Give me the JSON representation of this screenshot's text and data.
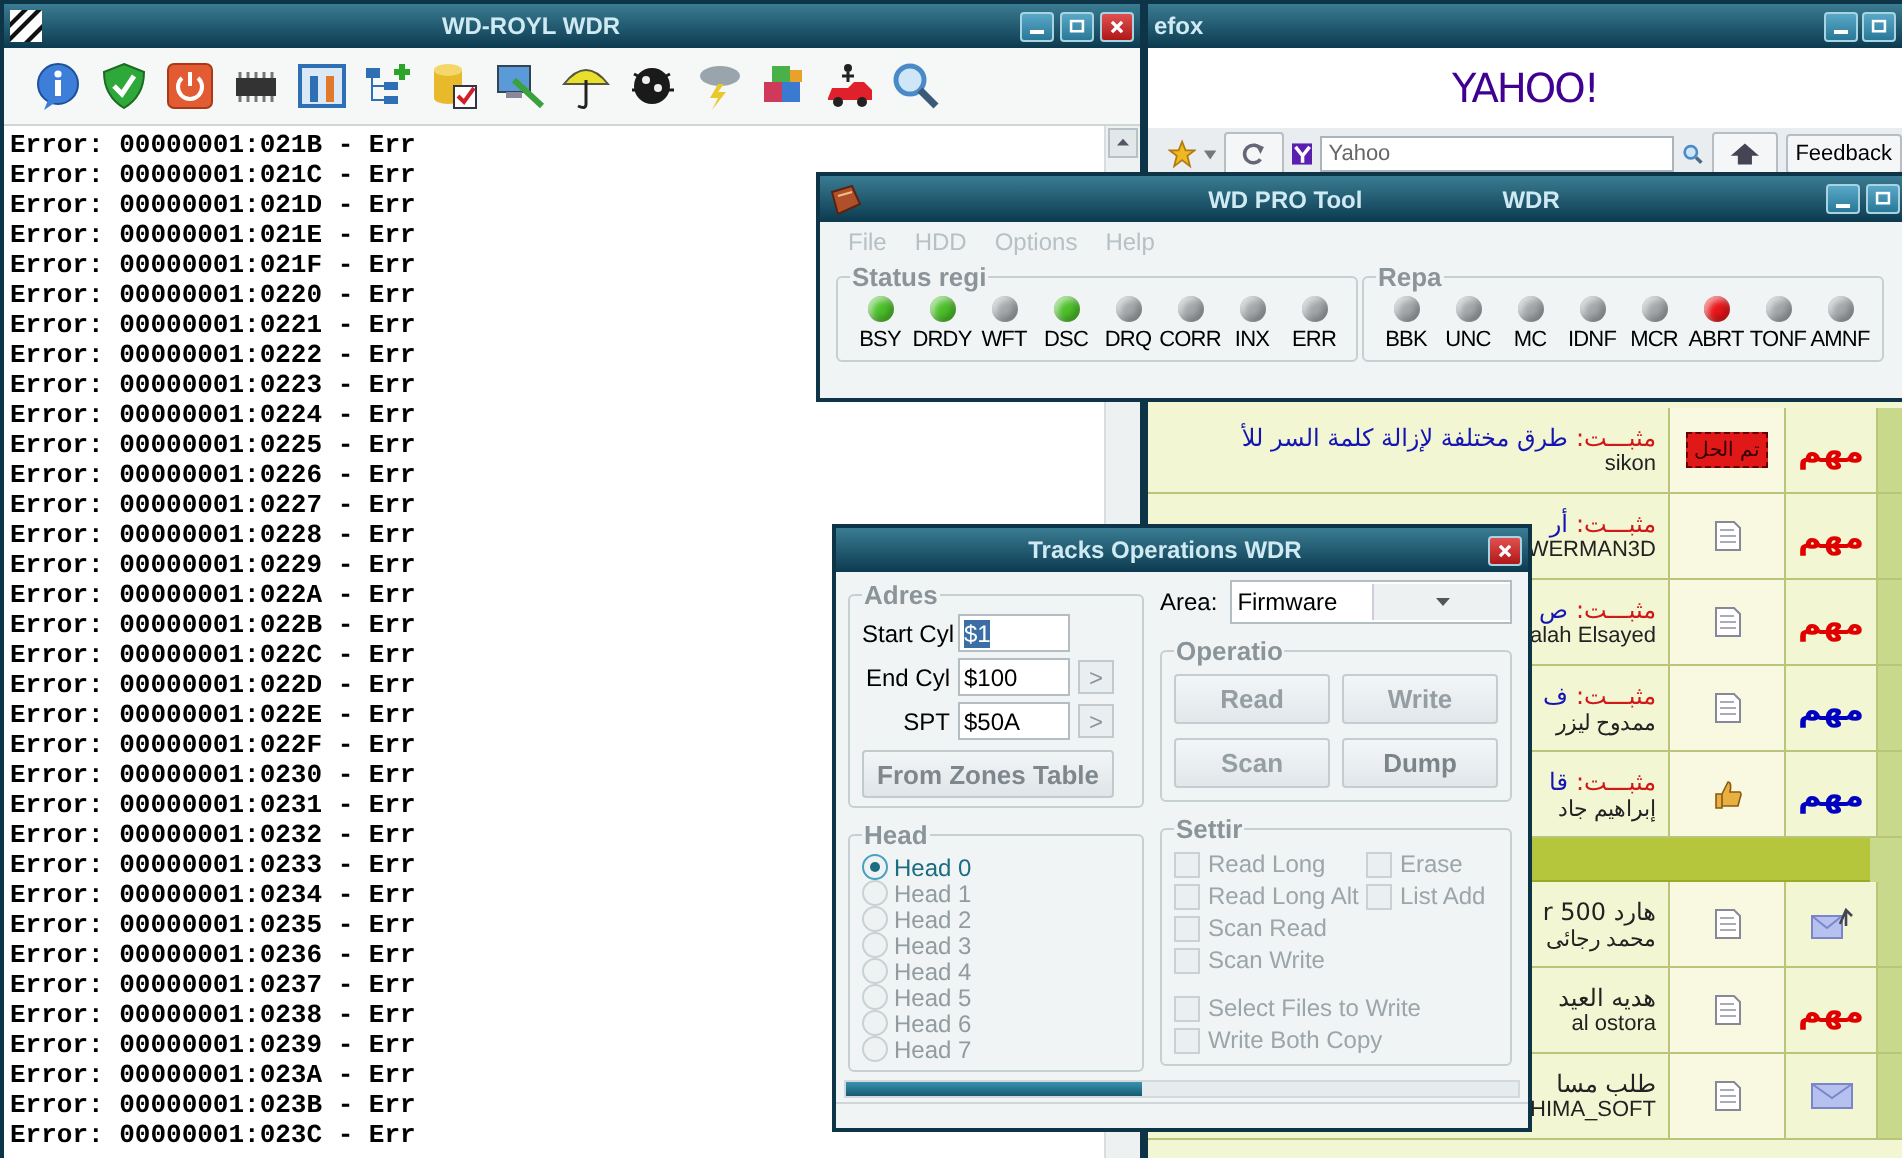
{
  "log_window": {
    "title": "WD-ROYL WDR",
    "lines": [
      "Error: 00000001:021B - Err",
      "Error: 00000001:021C - Err",
      "Error: 00000001:021D - Err",
      "Error: 00000001:021E - Err",
      "Error: 00000001:021F - Err",
      "Error: 00000001:0220 - Err",
      "Error: 00000001:0221 - Err",
      "Error: 00000001:0222 - Err",
      "Error: 00000001:0223 - Err",
      "Error: 00000001:0224 - Err",
      "Error: 00000001:0225 - Err",
      "Error: 00000001:0226 - Err",
      "Error: 00000001:0227 - Err",
      "Error: 00000001:0228 - Err",
      "Error: 00000001:0229 - Err",
      "Error: 00000001:022A - Err",
      "Error: 00000001:022B - Err",
      "Error: 00000001:022C - Err",
      "Error: 00000001:022D - Err",
      "Error: 00000001:022E - Err",
      "Error: 00000001:022F - Err",
      "Error: 00000001:0230 - Err",
      "Error: 00000001:0231 - Err",
      "Error: 00000001:0232 - Err",
      "Error: 00000001:0233 - Err",
      "Error: 00000001:0234 - Err",
      "Error: 00000001:0235 - Err",
      "Error: 00000001:0236 - Err",
      "Error: 00000001:0237 - Err",
      "Error: 00000001:0238 - Err",
      "Error: 00000001:0239 - Err",
      "Error: 00000001:023A - Err",
      "Error: 00000001:023B - Err",
      "Error: 00000001:023C - Err"
    ]
  },
  "browser": {
    "title": "efox",
    "logo": "YAHOO!",
    "search": {
      "placeholder": "Yahoo"
    },
    "feedback": "Feedback",
    "threads": [
      {
        "kind": "thread",
        "tag": "مثبـــت:",
        "title": "طرق مختلفة لإزالة كلمة السر للأ",
        "author": "sikon",
        "icon": {
          "kind": "solved",
          "text": "تم الحل"
        },
        "badge": {
          "kind": "important",
          "text": "مهم",
          "color": "#e00000"
        }
      },
      {
        "kind": "thread",
        "tag": "مثبـــت:",
        "title": "أر",
        "author": "WERMAN3D",
        "icon": {
          "kind": "document"
        },
        "badge": {
          "kind": "important",
          "text": "مهم",
          "color": "#e00000"
        }
      },
      {
        "kind": "thread",
        "tag": "مثبـــت:",
        "title": "ص",
        "author": "alah Elsayed",
        "icon": {
          "kind": "document"
        },
        "badge": {
          "kind": "important",
          "text": "مهم",
          "color": "#e00000"
        }
      },
      {
        "kind": "thread",
        "tag": "مثبـــت:",
        "title": "ف",
        "author": "ممدوح ليزر",
        "icon": {
          "kind": "document"
        },
        "badge": {
          "kind": "important",
          "text": "مهم",
          "color": "#0000c0"
        }
      },
      {
        "kind": "thread",
        "tag": "مثبـــت:",
        "title": "قا",
        "author": "إبراهيم جاد",
        "icon": {
          "kind": "thumbs-up"
        },
        "badge": {
          "kind": "important",
          "text": "مهم",
          "color": "#0000c0"
        }
      },
      {
        "kind": "separator"
      },
      {
        "kind": "thread",
        "title": "هارد 500 r",
        "author": "محمد رجائى",
        "icon": {
          "kind": "document"
        },
        "badge": {
          "kind": "envelope-arrow"
        }
      },
      {
        "kind": "thread",
        "title": "هديه العيد",
        "author": "al ostora",
        "icon": {
          "kind": "document"
        },
        "badge": {
          "kind": "important",
          "text": "مهم",
          "color": "#e00000"
        }
      },
      {
        "kind": "thread",
        "title": "طلب مسا",
        "author": "HIMA_SOFT",
        "icon": {
          "kind": "document"
        },
        "badge": {
          "kind": "envelope"
        }
      }
    ]
  },
  "pro_tool": {
    "title": "WD PRO Tool",
    "subtitle": "WDR",
    "menu": [
      {
        "label": "File",
        "disabled": true
      },
      {
        "label": "HDD",
        "disabled": true
      },
      {
        "label": "Options",
        "disabled": true
      },
      {
        "label": "Help",
        "disabled": true
      }
    ],
    "groups": [
      {
        "title": "Status regi",
        "leds": [
          {
            "label": "BSY",
            "color": "#4cbf2a"
          },
          {
            "label": "DRDY",
            "color": "#4cbf2a"
          },
          {
            "label": "WFT",
            "color": "#a3a7aa"
          },
          {
            "label": "DSC",
            "color": "#4cbf2a"
          },
          {
            "label": "DRQ",
            "color": "#a3a7aa"
          },
          {
            "label": "CORR",
            "color": "#a3a7aa"
          },
          {
            "label": "INX",
            "color": "#a3a7aa"
          },
          {
            "label": "ERR",
            "color": "#a3a7aa"
          }
        ]
      },
      {
        "title": "Repa",
        "leds": [
          {
            "label": "BBK",
            "color": "#a3a7aa"
          },
          {
            "label": "UNC",
            "color": "#a3a7aa"
          },
          {
            "label": "MC",
            "color": "#a3a7aa"
          },
          {
            "label": "IDNF",
            "color": "#a3a7aa"
          },
          {
            "label": "MCR",
            "color": "#a3a7aa"
          },
          {
            "label": "ABRT",
            "color": "#e8161a"
          },
          {
            "label": "TONF",
            "color": "#a3a7aa"
          },
          {
            "label": "AMNF",
            "color": "#a3a7aa"
          }
        ]
      }
    ]
  },
  "tracks": {
    "title": "Tracks Operations WDR",
    "address": {
      "title": "Adres",
      "fields": [
        {
          "label": "Start Cyl",
          "value": "$1",
          "selected": true
        },
        {
          "label": "End Cyl",
          "value": "$100",
          "selected": false,
          "button": ">"
        },
        {
          "label": "SPT",
          "value": "$50A",
          "selected": false,
          "button": ">"
        }
      ],
      "zones_button": "From Zones Table"
    },
    "area": {
      "label": "Area:",
      "value": "Firmware"
    },
    "operation": {
      "title": "Operatio",
      "buttons": [
        {
          "label": "Read",
          "disabled": true
        },
        {
          "label": "Write",
          "disabled": true
        },
        {
          "label": "Scan",
          "disabled": true
        },
        {
          "label": "Dump",
          "disabled": false
        }
      ]
    },
    "head": {
      "title": "Head",
      "options": [
        {
          "label": "Head 0",
          "selected": true,
          "disabled": false
        },
        {
          "label": "Head 1",
          "selected": false,
          "disabled": true
        },
        {
          "label": "Head 2",
          "selected": false,
          "disabled": true
        },
        {
          "label": "Head 3",
          "selected": false,
          "disabled": true
        },
        {
          "label": "Head 4",
          "selected": false,
          "disabled": true
        },
        {
          "label": "Head 5",
          "selected": false,
          "disabled": true
        },
        {
          "label": "Head 6",
          "selected": false,
          "disabled": true
        },
        {
          "label": "Head 7",
          "selected": false,
          "disabled": true
        }
      ]
    },
    "settings": {
      "title": "Settir",
      "rows": [
        [
          {
            "label": "Read Long",
            "checked": false,
            "disabled": true
          },
          {
            "label": "Erase",
            "checked": false,
            "disabled": true
          }
        ],
        [
          {
            "label": "Read Long Alt",
            "checked": false,
            "disabled": true
          },
          {
            "label": "List Add",
            "checked": false,
            "disabled": true
          }
        ],
        [
          {
            "label": "Scan Read",
            "checked": false,
            "disabled": true
          }
        ],
        [
          {
            "label": "Scan Write",
            "checked": false,
            "disabled": true
          }
        ]
      ],
      "file_options": [
        {
          "label": "Select Files to Write",
          "checked": false,
          "disabled": true
        },
        {
          "label": "Write Both Copy",
          "checked": false,
          "disabled": true
        }
      ]
    },
    "progress": {
      "level": 0.44
    }
  }
}
